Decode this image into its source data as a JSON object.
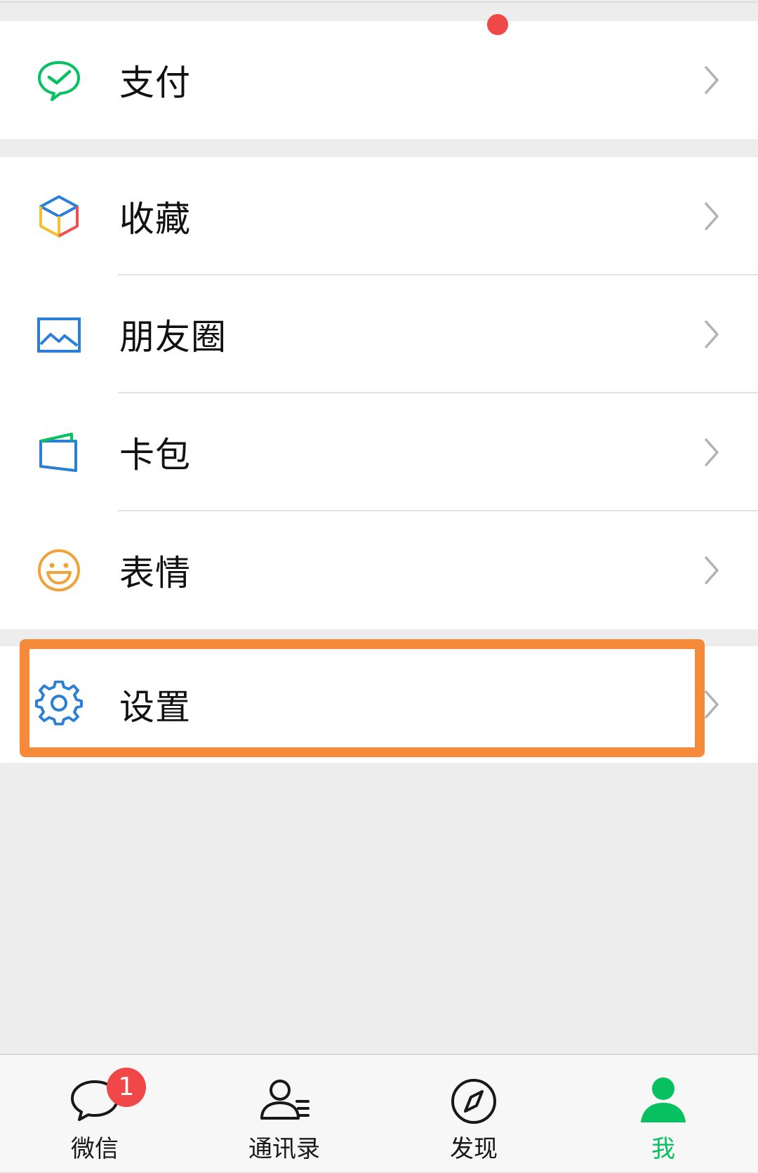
{
  "menu": {
    "pay": {
      "label": "支付",
      "icon": "wechat-pay-icon",
      "color": "#07c160"
    },
    "favorites": {
      "label": "收藏",
      "icon": "cube-icon"
    },
    "moments": {
      "label": "朋友圈",
      "icon": "image-icon",
      "color": "#2b7fd6"
    },
    "cards": {
      "label": "卡包",
      "icon": "card-icon",
      "color": "#2b7fd6"
    },
    "stickers": {
      "label": "表情",
      "icon": "smiley-icon",
      "color": "#f0a33a"
    },
    "settings": {
      "label": "设置",
      "icon": "gear-icon",
      "color": "#2b7fd6"
    }
  },
  "tabs": [
    {
      "label": "微信",
      "icon": "chat-bubble-icon",
      "badge": "1"
    },
    {
      "label": "通讯录",
      "icon": "contacts-icon"
    },
    {
      "label": "发现",
      "icon": "compass-icon"
    },
    {
      "label": "我",
      "icon": "person-icon",
      "active": true,
      "color": "#07c160"
    }
  ],
  "highlight_color": "#f58a3a"
}
